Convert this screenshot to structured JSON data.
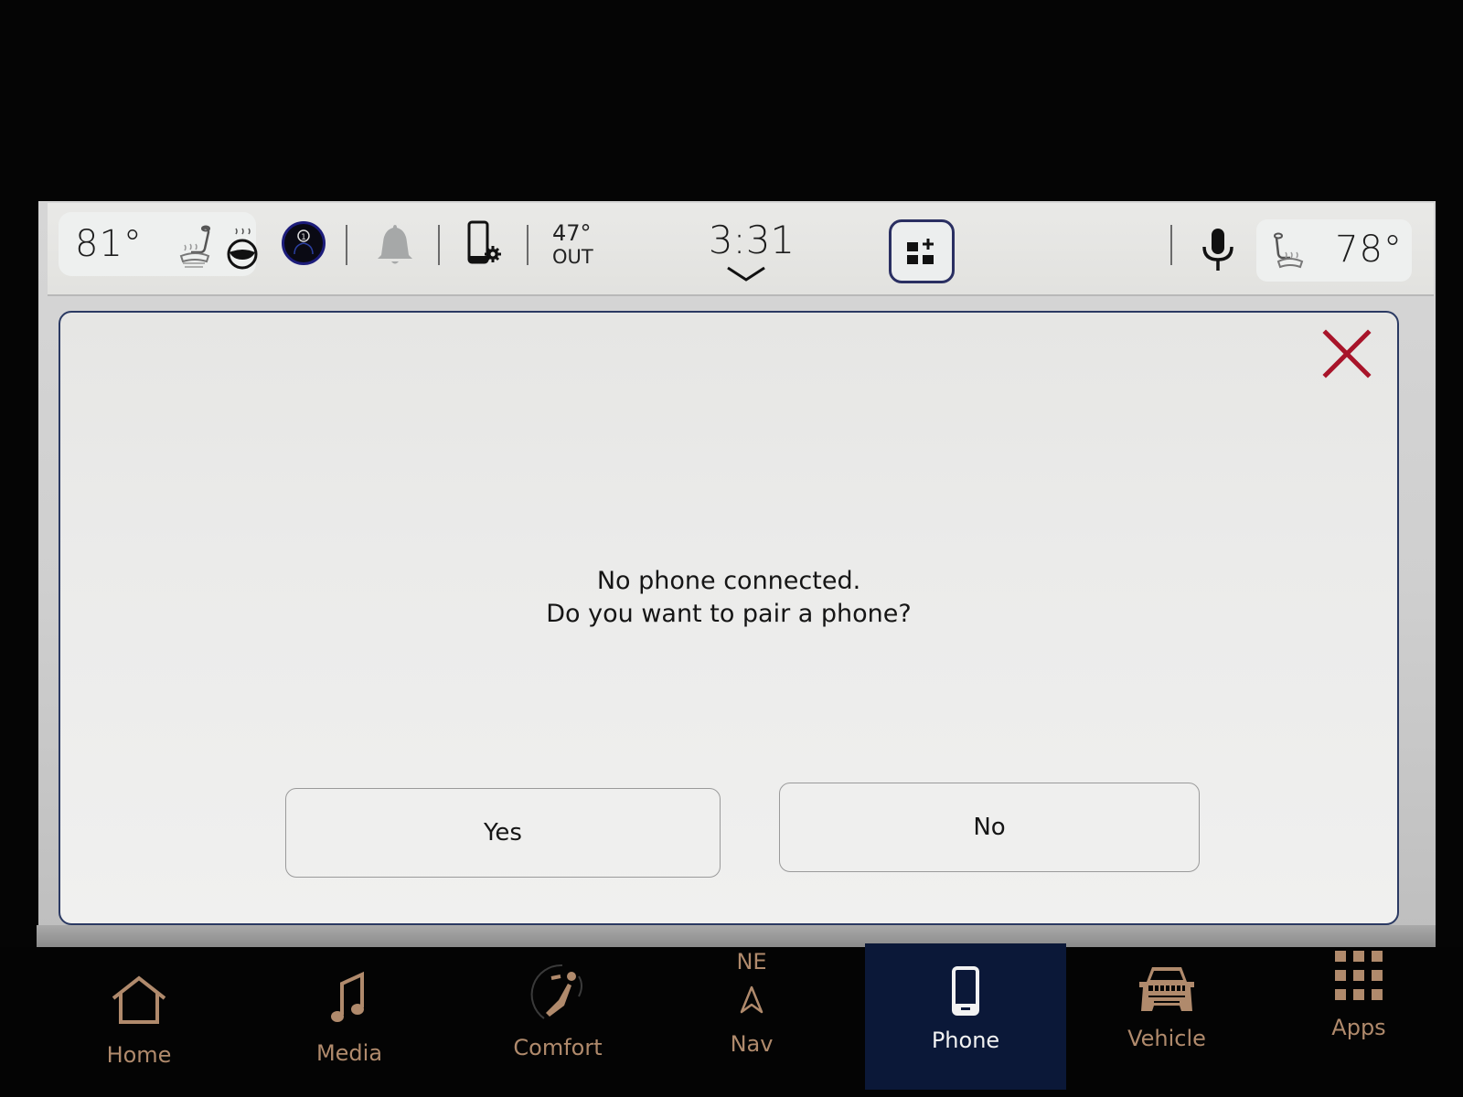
{
  "status_bar": {
    "driver_temp": "81°",
    "passenger_temp": "78°",
    "outside_temp": "47°",
    "outside_label": "OUT",
    "clock": "3:31",
    "icons": {
      "driver_seat": "heated-seat-icon",
      "steering_wheel": "heated-steering-wheel-icon",
      "profile": "driver-profile-icon",
      "notifications": "bell-icon",
      "phone_settings": "phone-settings-icon",
      "clock_expand": "chevron-down-icon",
      "widgets": "add-widget-icon",
      "voice": "microphone-icon",
      "passenger_seat": "heated-seat-icon"
    },
    "profile_number": "1"
  },
  "dialog": {
    "message_line1": "No phone connected.",
    "message_line2": "Do you want to pair a phone?",
    "yes_label": "Yes",
    "no_label": "No",
    "close_icon": "close-icon",
    "close_color": "#b0142a"
  },
  "bottom_nav": {
    "items": [
      {
        "label": "Home",
        "icon": "home-icon"
      },
      {
        "label": "Media",
        "icon": "music-note-icon"
      },
      {
        "label": "Comfort",
        "icon": "comfort-seat-icon"
      },
      {
        "label": "Nav",
        "icon": "navigation-arrow-icon",
        "heading": "NE"
      },
      {
        "label": "Phone",
        "icon": "phone-icon",
        "active": true
      },
      {
        "label": "Vehicle",
        "icon": "vehicle-icon"
      },
      {
        "label": "Apps",
        "icon": "apps-grid-icon"
      }
    ],
    "accent_color": "#b08a6c",
    "active_bg": "#0b1838"
  }
}
